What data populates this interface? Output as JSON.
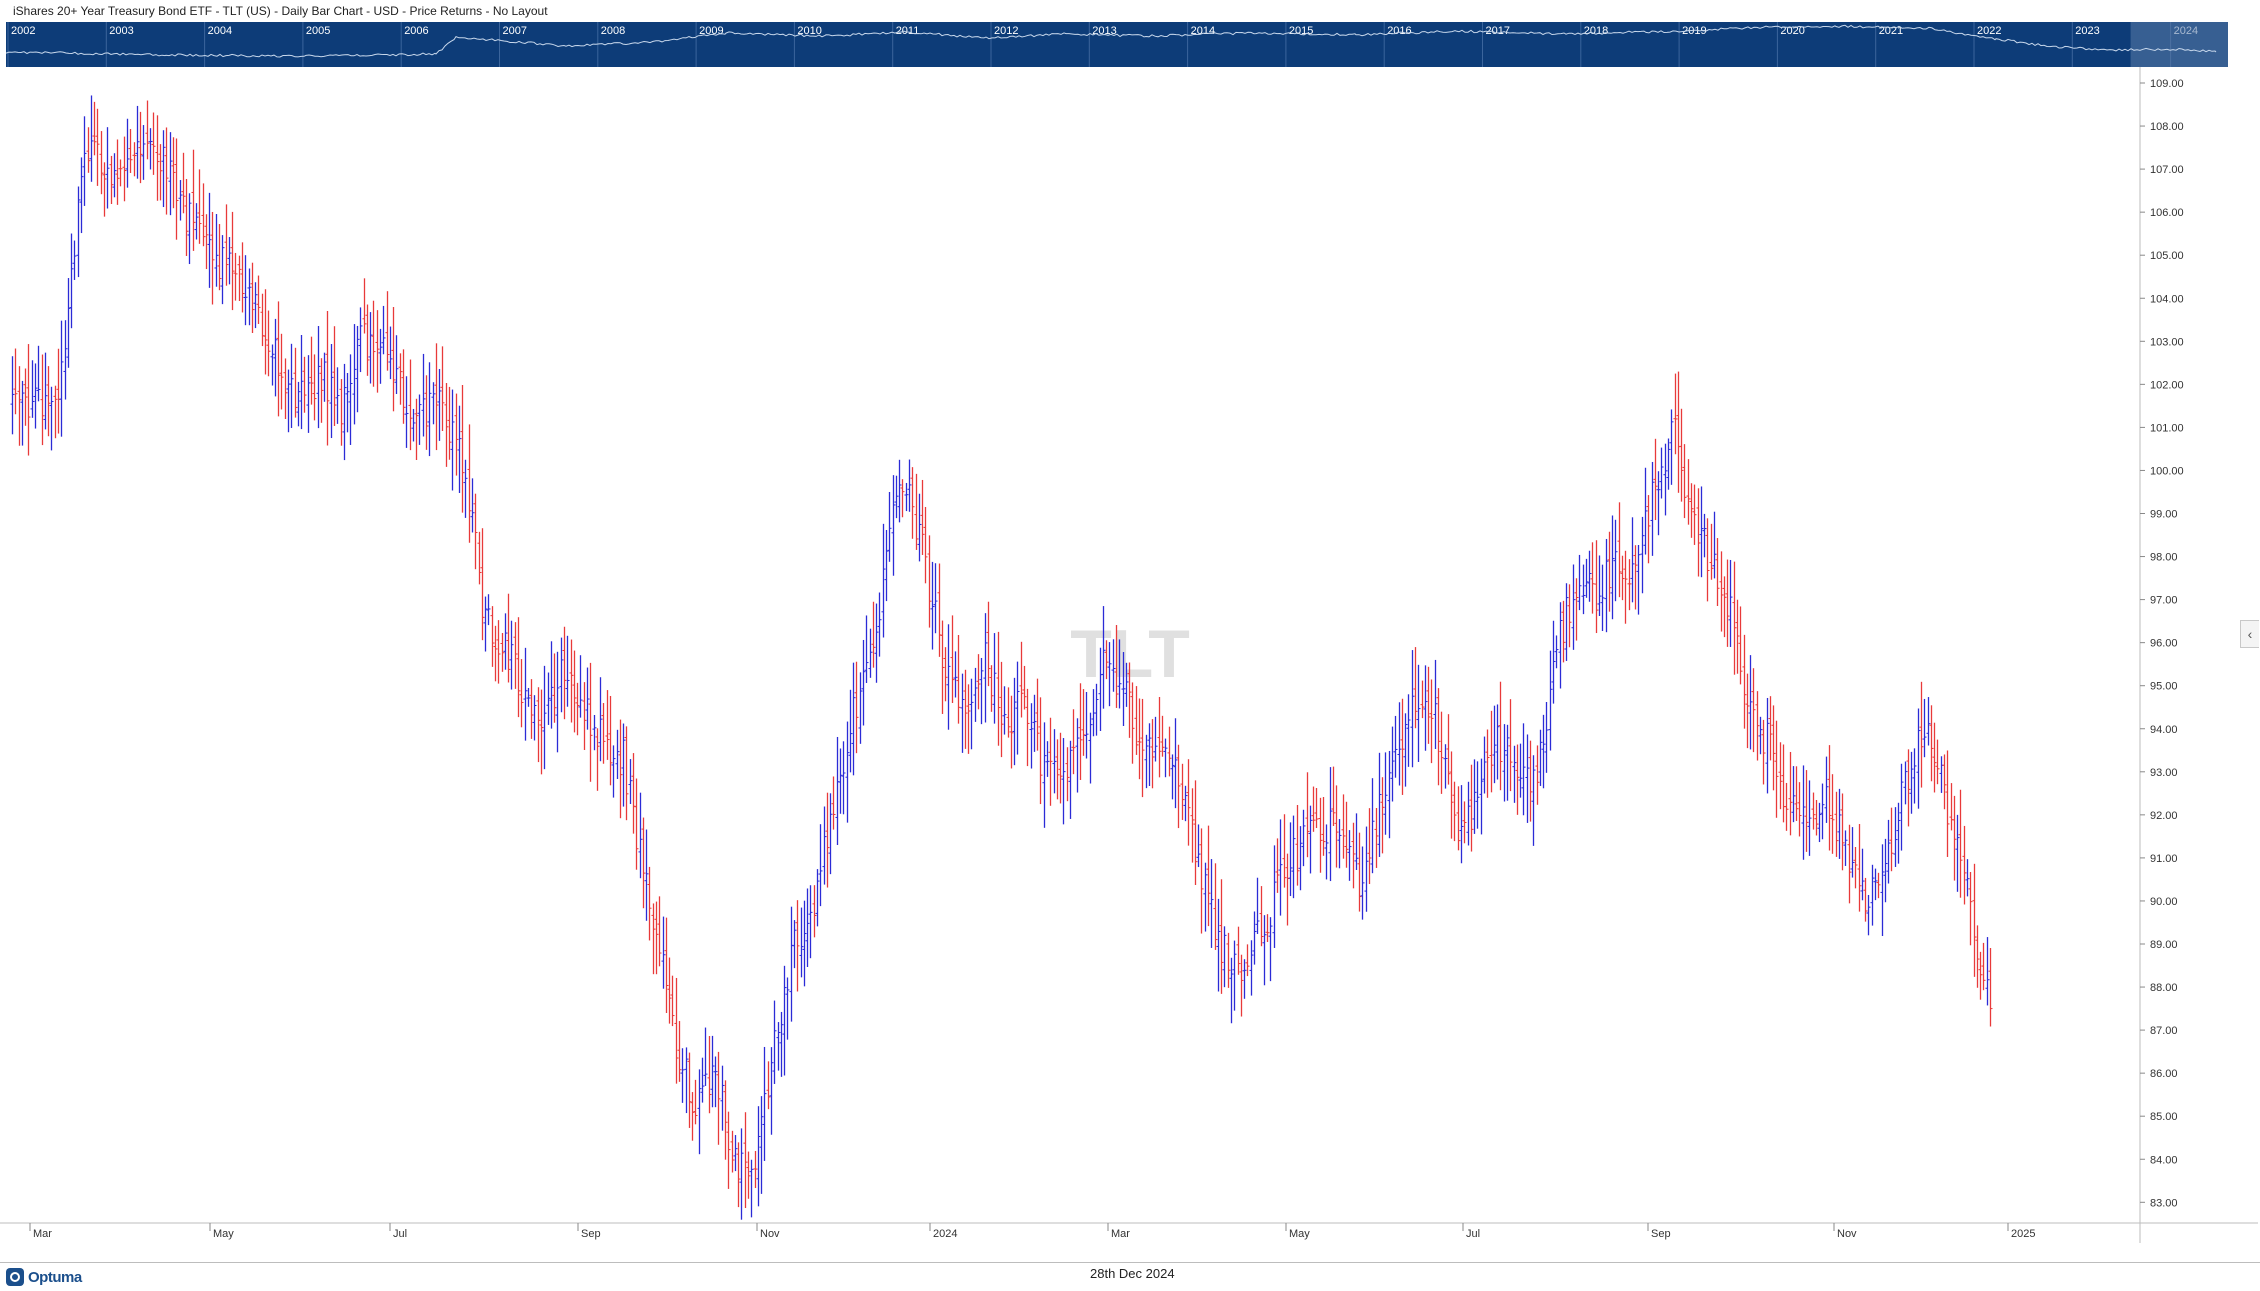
{
  "header": {
    "title": "iShares 20+ Year Treasury Bond ETF - TLT (US) - Daily Bar Chart - USD - Price Returns - No Layout"
  },
  "navigator": {
    "years": [
      "2002",
      "2003",
      "2004",
      "2005",
      "2006",
      "2007",
      "2008",
      "2009",
      "2010",
      "2011",
      "2012",
      "2013",
      "2014",
      "2015",
      "2016",
      "2017",
      "2018",
      "2019",
      "2020",
      "2021",
      "2022",
      "2023",
      "2024"
    ],
    "background_color": "#0d3c78",
    "line_color": "#c8d8ec",
    "selection_color": "#5b7ca8"
  },
  "chart_data": {
    "type": "ohlc",
    "symbol_watermark": "TLT",
    "y_ticks": [
      "109.00",
      "108.00",
      "107.00",
      "106.00",
      "105.00",
      "104.00",
      "103.00",
      "102.00",
      "101.00",
      "100.00",
      "99.00",
      "98.00",
      "97.00",
      "96.00",
      "95.00",
      "94.00",
      "93.00",
      "92.00",
      "91.00",
      "90.00",
      "89.00",
      "88.00",
      "87.00",
      "86.00",
      "85.00",
      "84.00",
      "83.00"
    ],
    "ylim": [
      82.2,
      109.2
    ],
    "x_labels": [
      "Mar",
      "May",
      "Jul",
      "Sep",
      "Nov",
      "2024",
      "Mar",
      "May",
      "Jul",
      "Sep",
      "Nov",
      "2025"
    ],
    "up_color": "#2b2bd6",
    "down_color": "#e83a3a",
    "anchors": [
      [
        0,
        101.9
      ],
      [
        10,
        101.4
      ],
      [
        14,
        101.7
      ],
      [
        22,
        107.4
      ],
      [
        30,
        107.0
      ],
      [
        40,
        107.7
      ],
      [
        46,
        107.1
      ],
      [
        55,
        105.6
      ],
      [
        62,
        104.9
      ],
      [
        70,
        104.3
      ],
      [
        78,
        103.0
      ],
      [
        86,
        101.8
      ],
      [
        94,
        102.2
      ],
      [
        100,
        101.5
      ],
      [
        106,
        103.1
      ],
      [
        114,
        102.7
      ],
      [
        122,
        101.4
      ],
      [
        130,
        101.4
      ],
      [
        138,
        100.1
      ],
      [
        144,
        96.4
      ],
      [
        150,
        96.0
      ],
      [
        156,
        94.8
      ],
      [
        162,
        94.1
      ],
      [
        168,
        95.4
      ],
      [
        174,
        94.4
      ],
      [
        180,
        93.7
      ],
      [
        186,
        93.3
      ],
      [
        191,
        91.0
      ],
      [
        196,
        89.3
      ],
      [
        202,
        86.6
      ],
      [
        208,
        85.3
      ],
      [
        214,
        86.2
      ],
      [
        220,
        83.9
      ],
      [
        226,
        83.9
      ],
      [
        232,
        86.7
      ],
      [
        238,
        89.0
      ],
      [
        244,
        90.0
      ],
      [
        250,
        92.2
      ],
      [
        256,
        94.5
      ],
      [
        262,
        95.5
      ],
      [
        267,
        98.7
      ],
      [
        272,
        99.6
      ],
      [
        278,
        97.8
      ],
      [
        284,
        95.3
      ],
      [
        290,
        94.4
      ],
      [
        296,
        95.6
      ],
      [
        302,
        94.2
      ],
      [
        308,
        94.6
      ],
      [
        314,
        93.0
      ],
      [
        320,
        93.2
      ],
      [
        326,
        93.7
      ],
      [
        332,
        95.7
      ],
      [
        338,
        95.0
      ],
      [
        344,
        93.5
      ],
      [
        350,
        94.0
      ],
      [
        356,
        92.4
      ],
      [
        362,
        90.6
      ],
      [
        368,
        89.0
      ],
      [
        374,
        88.3
      ],
      [
        380,
        89.3
      ],
      [
        386,
        90.4
      ],
      [
        392,
        91.3
      ],
      [
        398,
        91.6
      ],
      [
        404,
        91.7
      ],
      [
        410,
        90.5
      ],
      [
        416,
        92.2
      ],
      [
        422,
        93.7
      ],
      [
        428,
        94.7
      ],
      [
        434,
        94.1
      ],
      [
        440,
        91.4
      ],
      [
        446,
        92.4
      ],
      [
        452,
        93.8
      ],
      [
        458,
        93.0
      ],
      [
        464,
        92.8
      ],
      [
        470,
        95.8
      ],
      [
        476,
        97.4
      ],
      [
        482,
        97.2
      ],
      [
        488,
        97.8
      ],
      [
        494,
        97.6
      ],
      [
        500,
        99.8
      ],
      [
        506,
        100.9
      ],
      [
        510,
        98.9
      ],
      [
        516,
        98.1
      ],
      [
        522,
        97.0
      ],
      [
        528,
        94.8
      ],
      [
        534,
        93.7
      ],
      [
        540,
        92.3
      ],
      [
        546,
        92.1
      ],
      [
        552,
        92.3
      ],
      [
        558,
        91.2
      ],
      [
        564,
        90.2
      ],
      [
        570,
        90.6
      ],
      [
        576,
        92.7
      ],
      [
        582,
        94.1
      ],
      [
        588,
        92.5
      ],
      [
        594,
        90.6
      ],
      [
        598,
        88.6
      ],
      [
        602,
        87.5
      ]
    ]
  },
  "footer": {
    "brand": "Optuma",
    "date": "28th Dec 2024"
  }
}
